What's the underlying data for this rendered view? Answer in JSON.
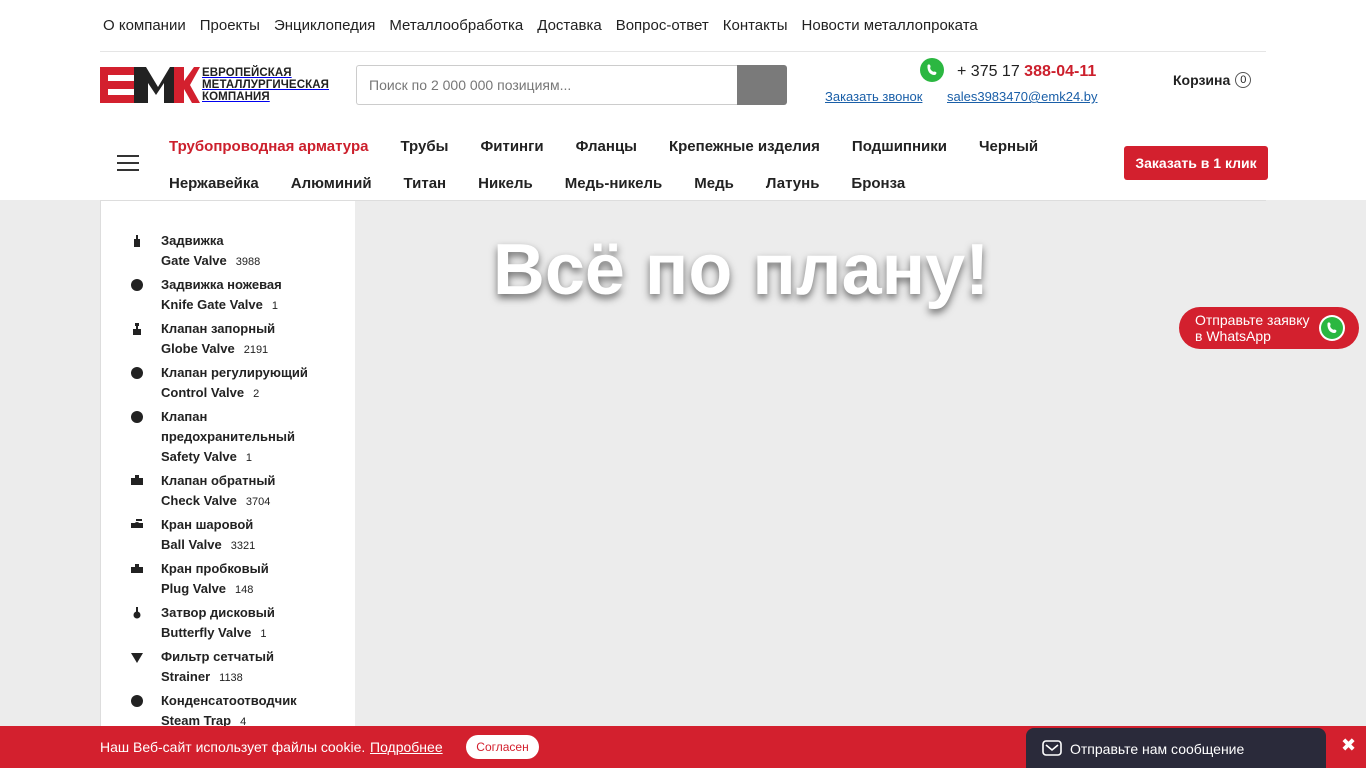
{
  "topnav": [
    "О компании",
    "Проекты",
    "Энциклопедия",
    "Металлообработка",
    "Доставка",
    "Вопрос-ответ",
    "Контакты",
    "Новости металлопроката"
  ],
  "logo": {
    "lines": [
      "Европейская",
      "металлургическая",
      "компания"
    ],
    "mark": "ЕМК"
  },
  "search": {
    "placeholder": "Поиск по 2 000 000 позициям..."
  },
  "contacts": {
    "phone_prefix": "+ 375 17 ",
    "phone_main": "388-04-11",
    "callback": "Заказать звонок",
    "email": "sales3983470@emk24.by"
  },
  "cart": {
    "label": "Корзина",
    "count": "0"
  },
  "categories_row1": [
    {
      "label": "Трубопроводная арматура",
      "active": true
    },
    {
      "label": "Трубы"
    },
    {
      "label": "Фитинги"
    },
    {
      "label": "Фланцы"
    },
    {
      "label": "Крепежные изделия"
    },
    {
      "label": "Подшипники"
    },
    {
      "label": "Черный"
    }
  ],
  "categories_row2": [
    {
      "label": "Нержавейка"
    },
    {
      "label": "Алюминий"
    },
    {
      "label": "Титан"
    },
    {
      "label": "Никель"
    },
    {
      "label": "Медь-никель"
    },
    {
      "label": "Медь"
    },
    {
      "label": "Латунь"
    },
    {
      "label": "Бронза"
    }
  ],
  "order_button": "Заказать в 1 клик",
  "sidebar": [
    {
      "name_ru": "Задвижка",
      "name_en": "Gate Valve",
      "count": "3988",
      "icon": "gate-valve-icon"
    },
    {
      "name_ru": "Задвижка ножевая",
      "name_en": "Knife Gate Valve",
      "count": "1",
      "icon": "dot-icon"
    },
    {
      "name_ru": "Клапан запорный",
      "name_en": "Globe Valve",
      "count": "2191",
      "icon": "globe-valve-icon"
    },
    {
      "name_ru": "Клапан регулирующий",
      "name_en": "Control Valve",
      "count": "2",
      "icon": "dot-icon"
    },
    {
      "name_ru": "Клапан предохранительный",
      "name_en": "Safety Valve",
      "count": "1",
      "icon": "dot-icon"
    },
    {
      "name_ru": "Клапан обратный",
      "name_en": "Check Valve",
      "count": "3704",
      "icon": "check-valve-icon"
    },
    {
      "name_ru": "Кран шаровой",
      "name_en": "Ball Valve",
      "count": "3321",
      "icon": "ball-valve-icon"
    },
    {
      "name_ru": "Кран пробковый",
      "name_en": "Plug Valve",
      "count": "148",
      "icon": "plug-valve-icon"
    },
    {
      "name_ru": "Затвор дисковый",
      "name_en": "Butterfly Valve",
      "count": "1",
      "icon": "butterfly-valve-icon"
    },
    {
      "name_ru": "Фильтр сетчатый",
      "name_en": "Strainer",
      "count": "1138",
      "icon": "strainer-icon"
    },
    {
      "name_ru": "Конденсатоотводчик",
      "name_en": "Steam Trap",
      "count": "4",
      "icon": "dot-icon"
    }
  ],
  "hero": "Всё по плану!",
  "whatsapp_float": {
    "line1": "Отправьте заявку",
    "line2": "в WhatsApp"
  },
  "cookie": {
    "text": "Наш Веб-сайт использует файлы cookie.",
    "more": "Подробнее",
    "agree": "Согласен",
    "close": "✖"
  },
  "message_widget": "Отправьте нам сообщение",
  "colors": {
    "accent": "#d3202e",
    "link": "#1a5fa8",
    "whatsapp": "#2bb741"
  }
}
